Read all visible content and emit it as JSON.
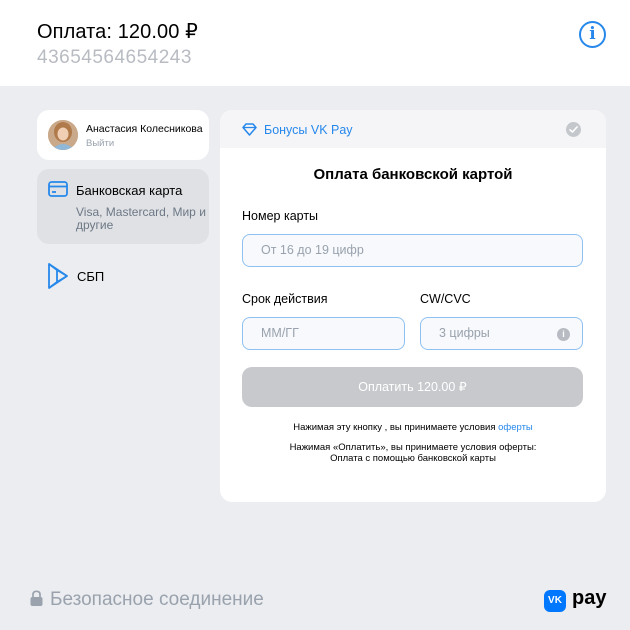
{
  "header": {
    "amount": "Оплата: 120.00 ₽",
    "order_id": "43654564654243",
    "info_icon": "info-icon",
    "info_glyph": "i"
  },
  "user": {
    "name": "Анастасия Колесникова",
    "logout": "Выйти"
  },
  "methods": [
    {
      "title": "Банковская карта",
      "subtitle": "Visa, Mastercard, Мир и другие",
      "icon": "card-icon",
      "selected": true
    },
    {
      "title": "СБП",
      "icon": "sbp-icon",
      "selected": false
    }
  ],
  "bonus": {
    "label": "Бонусы VK Pay",
    "icon": "diamond-icon",
    "checked": false
  },
  "form": {
    "title": "Оплата банковской картой",
    "card_label": "Номер карты",
    "card_placeholder": "От 16 до 19 цифр",
    "expiry_label": "Срок действия",
    "expiry_placeholder": "ММ/ГГ",
    "cvc_label": "CW/CVC",
    "cvc_placeholder": "3 цифры",
    "cvc_info_glyph": "i",
    "pay_button": "Оплатить 120.00 ₽",
    "terms_text": "Нажимая эту кнопку , вы принимаете условия ",
    "terms_link": "оферты",
    "terms2_line1": "Нажимая «Оплатить», вы принимаете условия оферты:",
    "terms2_line2": "Оплата с помощью банковской карты"
  },
  "footer": {
    "secure": "Безопасное соединение",
    "brand_mark": "VK",
    "brand_word": "pay"
  },
  "colors": {
    "accent": "#2688eb",
    "background": "#ebedf0",
    "disabled_button": "#c7c9cc"
  }
}
